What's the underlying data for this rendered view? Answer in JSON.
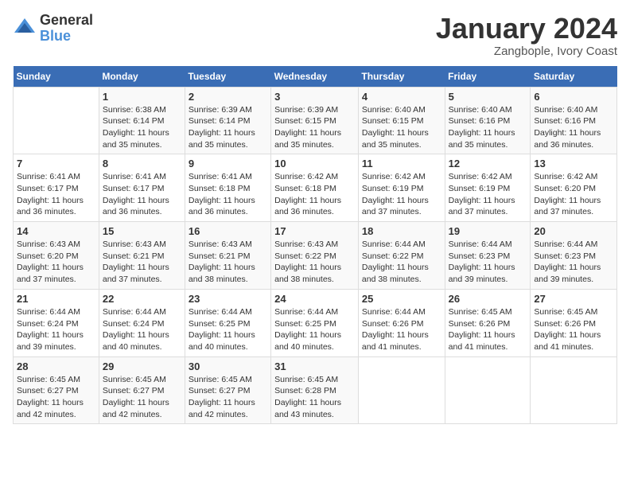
{
  "header": {
    "logo_general": "General",
    "logo_blue": "Blue",
    "month_title": "January 2024",
    "location": "Zangbople, Ivory Coast"
  },
  "days_of_week": [
    "Sunday",
    "Monday",
    "Tuesday",
    "Wednesday",
    "Thursday",
    "Friday",
    "Saturday"
  ],
  "weeks": [
    [
      {
        "day": "",
        "sunrise": "",
        "sunset": "",
        "daylight": ""
      },
      {
        "day": "1",
        "sunrise": "Sunrise: 6:38 AM",
        "sunset": "Sunset: 6:14 PM",
        "daylight": "Daylight: 11 hours and 35 minutes."
      },
      {
        "day": "2",
        "sunrise": "Sunrise: 6:39 AM",
        "sunset": "Sunset: 6:14 PM",
        "daylight": "Daylight: 11 hours and 35 minutes."
      },
      {
        "day": "3",
        "sunrise": "Sunrise: 6:39 AM",
        "sunset": "Sunset: 6:15 PM",
        "daylight": "Daylight: 11 hours and 35 minutes."
      },
      {
        "day": "4",
        "sunrise": "Sunrise: 6:40 AM",
        "sunset": "Sunset: 6:15 PM",
        "daylight": "Daylight: 11 hours and 35 minutes."
      },
      {
        "day": "5",
        "sunrise": "Sunrise: 6:40 AM",
        "sunset": "Sunset: 6:16 PM",
        "daylight": "Daylight: 11 hours and 35 minutes."
      },
      {
        "day": "6",
        "sunrise": "Sunrise: 6:40 AM",
        "sunset": "Sunset: 6:16 PM",
        "daylight": "Daylight: 11 hours and 36 minutes."
      }
    ],
    [
      {
        "day": "7",
        "sunrise": "Sunrise: 6:41 AM",
        "sunset": "Sunset: 6:17 PM",
        "daylight": "Daylight: 11 hours and 36 minutes."
      },
      {
        "day": "8",
        "sunrise": "Sunrise: 6:41 AM",
        "sunset": "Sunset: 6:17 PM",
        "daylight": "Daylight: 11 hours and 36 minutes."
      },
      {
        "day": "9",
        "sunrise": "Sunrise: 6:41 AM",
        "sunset": "Sunset: 6:18 PM",
        "daylight": "Daylight: 11 hours and 36 minutes."
      },
      {
        "day": "10",
        "sunrise": "Sunrise: 6:42 AM",
        "sunset": "Sunset: 6:18 PM",
        "daylight": "Daylight: 11 hours and 36 minutes."
      },
      {
        "day": "11",
        "sunrise": "Sunrise: 6:42 AM",
        "sunset": "Sunset: 6:19 PM",
        "daylight": "Daylight: 11 hours and 37 minutes."
      },
      {
        "day": "12",
        "sunrise": "Sunrise: 6:42 AM",
        "sunset": "Sunset: 6:19 PM",
        "daylight": "Daylight: 11 hours and 37 minutes."
      },
      {
        "day": "13",
        "sunrise": "Sunrise: 6:42 AM",
        "sunset": "Sunset: 6:20 PM",
        "daylight": "Daylight: 11 hours and 37 minutes."
      }
    ],
    [
      {
        "day": "14",
        "sunrise": "Sunrise: 6:43 AM",
        "sunset": "Sunset: 6:20 PM",
        "daylight": "Daylight: 11 hours and 37 minutes."
      },
      {
        "day": "15",
        "sunrise": "Sunrise: 6:43 AM",
        "sunset": "Sunset: 6:21 PM",
        "daylight": "Daylight: 11 hours and 37 minutes."
      },
      {
        "day": "16",
        "sunrise": "Sunrise: 6:43 AM",
        "sunset": "Sunset: 6:21 PM",
        "daylight": "Daylight: 11 hours and 38 minutes."
      },
      {
        "day": "17",
        "sunrise": "Sunrise: 6:43 AM",
        "sunset": "Sunset: 6:22 PM",
        "daylight": "Daylight: 11 hours and 38 minutes."
      },
      {
        "day": "18",
        "sunrise": "Sunrise: 6:44 AM",
        "sunset": "Sunset: 6:22 PM",
        "daylight": "Daylight: 11 hours and 38 minutes."
      },
      {
        "day": "19",
        "sunrise": "Sunrise: 6:44 AM",
        "sunset": "Sunset: 6:23 PM",
        "daylight": "Daylight: 11 hours and 39 minutes."
      },
      {
        "day": "20",
        "sunrise": "Sunrise: 6:44 AM",
        "sunset": "Sunset: 6:23 PM",
        "daylight": "Daylight: 11 hours and 39 minutes."
      }
    ],
    [
      {
        "day": "21",
        "sunrise": "Sunrise: 6:44 AM",
        "sunset": "Sunset: 6:24 PM",
        "daylight": "Daylight: 11 hours and 39 minutes."
      },
      {
        "day": "22",
        "sunrise": "Sunrise: 6:44 AM",
        "sunset": "Sunset: 6:24 PM",
        "daylight": "Daylight: 11 hours and 40 minutes."
      },
      {
        "day": "23",
        "sunrise": "Sunrise: 6:44 AM",
        "sunset": "Sunset: 6:25 PM",
        "daylight": "Daylight: 11 hours and 40 minutes."
      },
      {
        "day": "24",
        "sunrise": "Sunrise: 6:44 AM",
        "sunset": "Sunset: 6:25 PM",
        "daylight": "Daylight: 11 hours and 40 minutes."
      },
      {
        "day": "25",
        "sunrise": "Sunrise: 6:44 AM",
        "sunset": "Sunset: 6:26 PM",
        "daylight": "Daylight: 11 hours and 41 minutes."
      },
      {
        "day": "26",
        "sunrise": "Sunrise: 6:45 AM",
        "sunset": "Sunset: 6:26 PM",
        "daylight": "Daylight: 11 hours and 41 minutes."
      },
      {
        "day": "27",
        "sunrise": "Sunrise: 6:45 AM",
        "sunset": "Sunset: 6:26 PM",
        "daylight": "Daylight: 11 hours and 41 minutes."
      }
    ],
    [
      {
        "day": "28",
        "sunrise": "Sunrise: 6:45 AM",
        "sunset": "Sunset: 6:27 PM",
        "daylight": "Daylight: 11 hours and 42 minutes."
      },
      {
        "day": "29",
        "sunrise": "Sunrise: 6:45 AM",
        "sunset": "Sunset: 6:27 PM",
        "daylight": "Daylight: 11 hours and 42 minutes."
      },
      {
        "day": "30",
        "sunrise": "Sunrise: 6:45 AM",
        "sunset": "Sunset: 6:27 PM",
        "daylight": "Daylight: 11 hours and 42 minutes."
      },
      {
        "day": "31",
        "sunrise": "Sunrise: 6:45 AM",
        "sunset": "Sunset: 6:28 PM",
        "daylight": "Daylight: 11 hours and 43 minutes."
      },
      {
        "day": "",
        "sunrise": "",
        "sunset": "",
        "daylight": ""
      },
      {
        "day": "",
        "sunrise": "",
        "sunset": "",
        "daylight": ""
      },
      {
        "day": "",
        "sunrise": "",
        "sunset": "",
        "daylight": ""
      }
    ]
  ]
}
